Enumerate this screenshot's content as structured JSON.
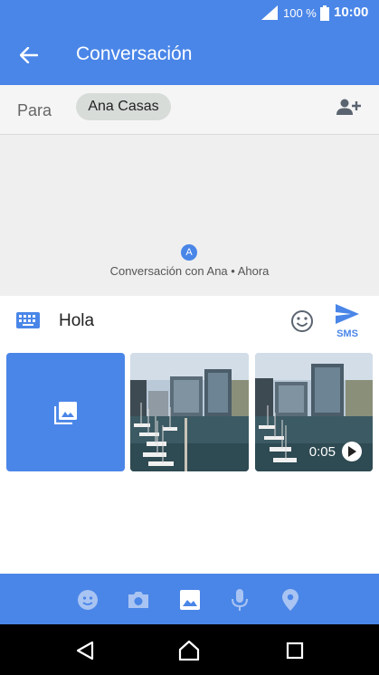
{
  "status_bar": {
    "battery_text": "100 %",
    "time": "10:00",
    "icons": [
      "signal-icon",
      "battery-icon"
    ]
  },
  "app_bar": {
    "title": "Conversación",
    "back_icon": "arrow-back-icon"
  },
  "recipient": {
    "label": "Para",
    "chip": "Ana Casas",
    "add_icon": "add-person-icon"
  },
  "conversation": {
    "avatar_letter": "A",
    "info": "Conversación con Ana • Ahora"
  },
  "compose": {
    "text": "Hola",
    "send_label": "SMS",
    "keyboard_icon": "keyboard-icon",
    "emoji_icon": "emoji-icon",
    "send_icon": "send-icon"
  },
  "media": {
    "gallery_icon": "gallery-icon",
    "video_duration": "0:05"
  },
  "attach_bar": {
    "icons": [
      "sticker-icon",
      "camera-icon",
      "image-icon",
      "mic-icon",
      "location-icon"
    ]
  },
  "nav_bar": {
    "icons": [
      "back-icon",
      "home-icon",
      "recents-icon"
    ]
  },
  "colors": {
    "accent": "#4a86e8",
    "chip_bg": "#d7dcd9",
    "convo_bg": "#efefef"
  }
}
